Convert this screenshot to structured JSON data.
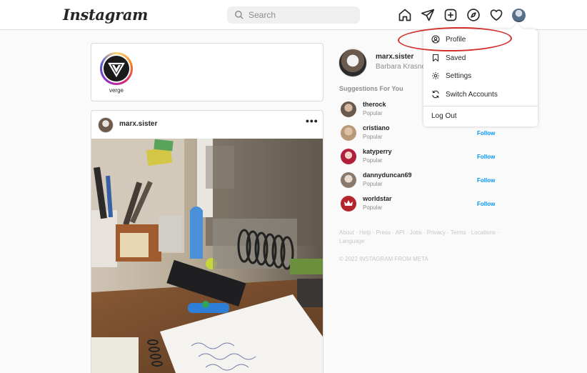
{
  "app": {
    "logo": "Instagram"
  },
  "search": {
    "placeholder": "Search"
  },
  "nav": {
    "icons": [
      "home-icon",
      "direct-icon",
      "new-post-icon",
      "explore-icon",
      "activity-icon"
    ]
  },
  "stories": [
    {
      "username": "verge"
    }
  ],
  "post": {
    "username": "marx.sister",
    "more": "•••"
  },
  "me": {
    "username": "marx.sister",
    "full_name": "Barbara Krasno"
  },
  "suggestions": {
    "title": "Suggestions For You",
    "items": [
      {
        "username": "therock",
        "subtitle": "Popular",
        "action": ""
      },
      {
        "username": "cristiano",
        "subtitle": "Popular",
        "action": "Follow"
      },
      {
        "username": "katyperry",
        "subtitle": "Popular",
        "action": "Follow"
      },
      {
        "username": "dannyduncan69",
        "subtitle": "Popular",
        "action": "Follow"
      },
      {
        "username": "worldstar",
        "subtitle": "Popular",
        "action": "Follow"
      }
    ]
  },
  "footer": {
    "links": "About · Help · Press · API · Jobs · Privacy · Terms · Locations · Language",
    "copyright": "© 2022 INSTAGRAM FROM META"
  },
  "dropdown": {
    "items": [
      {
        "label": "Profile",
        "icon": "profile-icon"
      },
      {
        "label": "Saved",
        "icon": "bookmark-icon"
      },
      {
        "label": "Settings",
        "icon": "settings-icon"
      },
      {
        "label": "Switch Accounts",
        "icon": "switch-icon"
      }
    ],
    "logout": "Log Out"
  },
  "colors": {
    "link_blue": "#0095f6",
    "annotation_red": "#d0312d"
  }
}
